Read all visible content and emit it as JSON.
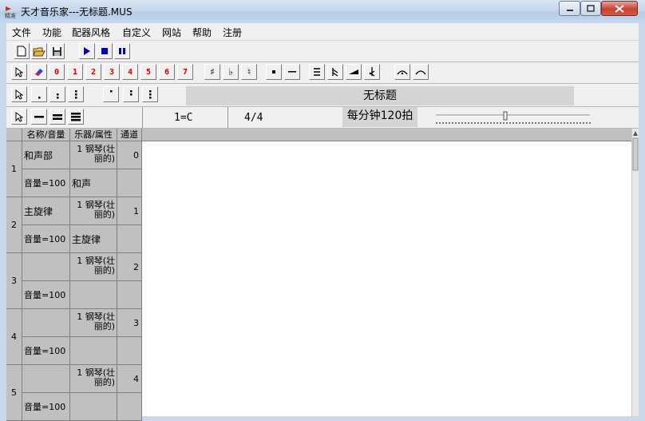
{
  "window": {
    "title": "天才音乐家---无标题.MUS",
    "app_icon_text": "精准"
  },
  "menu": [
    "文件",
    "功能",
    "配器风格",
    "自定义",
    "网站",
    "帮助",
    "注册"
  ],
  "toolbar1": {
    "numbers": [
      "0",
      "1",
      "2",
      "3",
      "4",
      "5",
      "6",
      "7"
    ],
    "sharp": "♯",
    "flat": "♭",
    "natural": "♮"
  },
  "toolbar2": {
    "song_title": "无标题"
  },
  "toolbar3": {
    "key": "1=C",
    "time_signature": "4/4",
    "tempo": "每分钟120拍"
  },
  "grid": {
    "headers": [
      "名称/音量",
      "乐器/属性",
      "通道"
    ],
    "tracks": [
      {
        "num": "1",
        "name": "和声部",
        "volume": "音量=100",
        "instrument": "1 钢琴(壮丽的)",
        "attribute": "和声",
        "channel": "0"
      },
      {
        "num": "2",
        "name": "主旋律",
        "volume": "音量=100",
        "instrument": "1 钢琴(壮丽的)",
        "attribute": "主旋律",
        "channel": "1"
      },
      {
        "num": "3",
        "name": "",
        "volume": "音量=100",
        "instrument": "1 钢琴(壮丽的)",
        "attribute": "",
        "channel": "2"
      },
      {
        "num": "4",
        "name": "",
        "volume": "音量=100",
        "instrument": "1 钢琴(壮丽的)",
        "attribute": "",
        "channel": "3"
      },
      {
        "num": "5",
        "name": "",
        "volume": "音量=100",
        "instrument": "1 钢琴(壮丽的)",
        "attribute": "",
        "channel": "4"
      }
    ]
  }
}
